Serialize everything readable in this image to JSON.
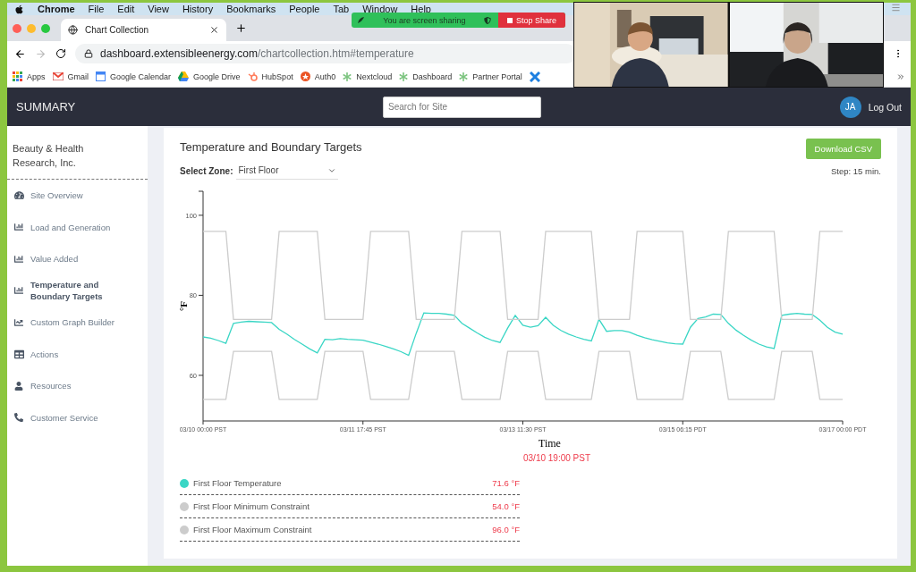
{
  "menu_bar": {
    "app": "Chrome",
    "items": [
      "File",
      "Edit",
      "View",
      "History",
      "Bookmarks",
      "People",
      "Tab",
      "Window",
      "Help"
    ]
  },
  "browser": {
    "tabs": [
      {
        "title": "Chart Collection",
        "selected": true
      }
    ],
    "url_host": "dashboard.extensibleenergy.com",
    "url_path": "/chartcollection.htm#temperature",
    "bookmarks": [
      {
        "kind": "apps",
        "label": "Apps"
      },
      {
        "kind": "gmail",
        "label": "Gmail"
      },
      {
        "kind": "calendar",
        "label": "Google Calendar"
      },
      {
        "kind": "drive",
        "label": "Google Drive"
      },
      {
        "kind": "hubspot",
        "label": "HubSpot"
      },
      {
        "kind": "auth0",
        "label": "Auth0"
      },
      {
        "kind": "spark",
        "label": "Nextcloud"
      },
      {
        "kind": "spark",
        "label": "Dashboard"
      },
      {
        "kind": "spark",
        "label": "Partner Portal"
      },
      {
        "kind": "cross"
      }
    ]
  },
  "share_banner": {
    "text": "You are screen sharing",
    "button": "Stop Share"
  },
  "header": {
    "title": "SUMMARY",
    "search": {
      "placeholder": "Search for Site"
    },
    "avatar": "JA",
    "logout": "Log Out"
  },
  "sidebar": {
    "company": "Beauty & Health Research, Inc.",
    "items": [
      {
        "kind": "gauge",
        "label": "Site Overview",
        "selected": false
      },
      {
        "kind": "bars",
        "label": "Load and Generation",
        "selected": false
      },
      {
        "kind": "bars",
        "label": "Value Added",
        "selected": false
      },
      {
        "kind": "bars",
        "label": "Temperature and Boundary Targets",
        "selected": true
      },
      {
        "kind": "line",
        "label": "Custom Graph Builder",
        "selected": false
      },
      {
        "kind": "table",
        "label": "Actions",
        "selected": false
      },
      {
        "kind": "user",
        "label": "Resources",
        "selected": false
      },
      {
        "kind": "phone",
        "label": "Customer Service",
        "selected": false
      }
    ]
  },
  "panel": {
    "title": "Temperature and Boundary Targets",
    "zone_label": "Select Zone:",
    "zone_value": "First Floor",
    "download": "Download CSV",
    "step": "Step: 15 min.",
    "chart_data": {
      "type": "line",
      "xlabel": "Time",
      "ylabel": "°F",
      "ylim": [
        48.6,
        106
      ],
      "yticks": [
        60,
        80,
        100
      ],
      "categories": [
        "03/10 00:00 PST",
        null,
        null,
        null,
        null,
        null,
        null,
        null,
        null,
        null,
        null,
        null,
        null,
        null,
        null,
        null,
        null,
        null,
        null,
        null,
        null,
        "03/11 17:45 PST",
        null,
        null,
        null,
        null,
        null,
        null,
        null,
        null,
        null,
        null,
        null,
        null,
        null,
        null,
        null,
        null,
        null,
        null,
        null,
        null,
        "03/13 11:30 PST",
        null,
        null,
        null,
        null,
        null,
        null,
        null,
        null,
        null,
        null,
        null,
        null,
        null,
        null,
        null,
        null,
        null,
        null,
        null,
        null,
        "03/15 06:15 PDT",
        null,
        null,
        null,
        null,
        null,
        null,
        null,
        null,
        null,
        null,
        null,
        null,
        null,
        null,
        null,
        null,
        null,
        null,
        null,
        null,
        "03/17 00:00 PDT"
      ],
      "series": [
        {
          "name": "First Floor Temperature",
          "color": "#3ad6c5",
          "values": [
            69.6,
            69.3,
            68.7,
            68.0,
            73.0,
            73.3,
            73.5,
            73.4,
            73.3,
            73.2,
            71.5,
            70.3,
            69.0,
            67.8,
            66.6,
            65.6,
            69.0,
            68.9,
            69.2,
            69.0,
            68.9,
            68.8,
            68.3,
            67.8,
            67.2,
            66.6,
            65.9,
            65.0,
            70.5,
            75.6,
            75.5,
            75.5,
            75.3,
            75.0,
            73.0,
            71.8,
            70.6,
            69.5,
            68.7,
            68.2,
            71.8,
            75.0,
            72.5,
            72.0,
            72.4,
            74.5,
            72.5,
            71.2,
            70.3,
            69.6,
            69.0,
            68.6,
            74.0,
            71.0,
            71.2,
            71.2,
            70.8,
            70.0,
            69.4,
            68.9,
            68.5,
            68.1,
            67.9,
            67.8,
            72.0,
            74.2,
            74.6,
            75.3,
            75.2,
            73.0,
            71.3,
            70.0,
            68.8,
            67.8,
            67.1,
            66.7,
            75.0,
            75.3,
            75.5,
            75.3,
            75.2,
            73.8,
            72.0,
            70.8,
            70.3
          ]
        },
        {
          "name": "First Floor Minimum Constraint",
          "color": "#cccccc",
          "values": [
            54,
            54,
            54,
            54,
            66,
            66,
            66,
            66,
            66,
            66,
            54,
            54,
            54,
            54,
            54,
            54,
            66,
            66,
            66,
            66,
            66,
            66,
            54,
            54,
            54,
            54,
            54,
            54,
            66,
            66,
            66,
            66,
            66,
            66,
            54,
            54,
            54,
            54,
            54,
            54,
            66,
            66,
            66,
            66,
            66,
            54,
            54,
            54,
            54,
            54,
            54,
            54,
            66,
            66,
            66,
            66,
            66,
            54,
            54,
            54,
            54,
            54,
            54,
            54,
            66,
            66,
            66,
            66,
            66,
            54,
            54,
            54,
            54,
            54,
            54,
            54,
            66,
            66,
            66,
            66,
            66,
            54,
            54,
            54,
            54
          ]
        },
        {
          "name": "First Floor Maximum Constraint",
          "color": "#cccccc",
          "values": [
            96,
            96,
            96,
            96,
            74,
            74,
            74,
            74,
            74,
            74,
            96,
            96,
            96,
            96,
            96,
            96,
            74,
            74,
            74,
            74,
            74,
            74,
            96,
            96,
            96,
            96,
            96,
            96,
            74,
            74,
            74,
            74,
            74,
            74,
            96,
            96,
            96,
            96,
            96,
            96,
            74,
            74,
            74,
            74,
            74,
            96,
            96,
            96,
            96,
            96,
            96,
            96,
            74,
            74,
            74,
            74,
            74,
            96,
            96,
            96,
            96,
            96,
            96,
            96,
            74,
            74,
            74,
            74,
            74,
            96,
            96,
            96,
            96,
            96,
            96,
            96,
            74,
            74,
            74,
            74,
            74,
            96,
            96,
            96,
            96
          ]
        }
      ]
    },
    "hover_time": "03/10 19:00 PST",
    "legend": [
      {
        "value": "71.6 °F"
      },
      {
        "value": "54.0 °F"
      },
      {
        "value": "96.0 °F"
      }
    ]
  }
}
